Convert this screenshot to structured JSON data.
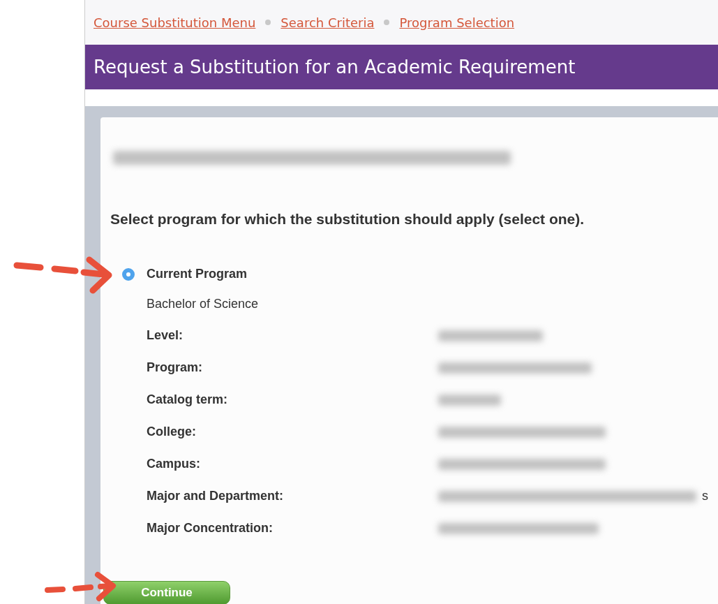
{
  "breadcrumbs": [
    {
      "label": "Course Substitution Menu"
    },
    {
      "label": "Search Criteria"
    },
    {
      "label": "Program Selection"
    }
  ],
  "page_title": "Request a Substitution for an Academic Requirement",
  "student_redacted": true,
  "instruction": "Select program for which the substitution should apply (select one).",
  "program": {
    "title": "Current Program",
    "selected": true,
    "degree": "Bachelor of Science",
    "fields": [
      {
        "label": "Level:",
        "value_redacted": true
      },
      {
        "label": "Program:",
        "value_redacted": true
      },
      {
        "label": "Catalog term:",
        "value_redacted": true
      },
      {
        "label": "College:",
        "value_redacted": true
      },
      {
        "label": "Campus:",
        "value_redacted": true
      },
      {
        "label": "Major and Department:",
        "value_redacted": true,
        "value_tail": "s"
      },
      {
        "label": "Major Concentration:",
        "value_redacted": true
      }
    ]
  },
  "continue_button": "Continue"
}
